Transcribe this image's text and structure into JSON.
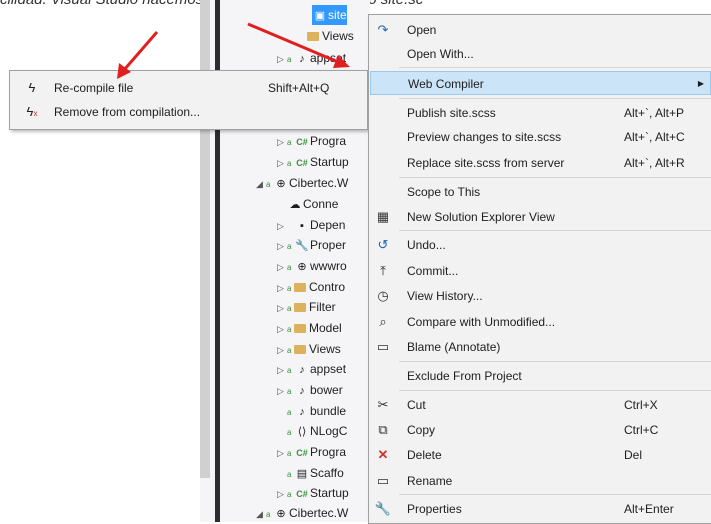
{
  "background_text": "cilidad. Visual Studio nacemos clic derecho en el archivo site.sc",
  "tree": {
    "items": [
      {
        "label": "site",
        "selected": true
      },
      {
        "label": "Views"
      },
      {
        "label": "appset"
      },
      {
        "label": "Progra"
      },
      {
        "label": "Startup"
      },
      {
        "label": "Cibertec.W"
      },
      {
        "label": "Conne"
      },
      {
        "label": "Depen"
      },
      {
        "label": "Proper"
      },
      {
        "label": "wwwro"
      },
      {
        "label": "Contro"
      },
      {
        "label": "Filter"
      },
      {
        "label": "Model"
      },
      {
        "label": "Views"
      },
      {
        "label": "appset"
      },
      {
        "label": "bower"
      },
      {
        "label": "bundle"
      },
      {
        "label": "NLogC"
      },
      {
        "label": "Progra"
      },
      {
        "label": "Scaffo"
      },
      {
        "label": "Startup"
      },
      {
        "label": "Cibertec.W"
      }
    ]
  },
  "submenu": {
    "items": [
      {
        "label": "Re-compile file",
        "shortcut": "Shift+Alt+Q",
        "icon": "lightning-icon"
      },
      {
        "label": "Remove from compilation...",
        "shortcut": "",
        "icon": "lightning-remove-icon"
      }
    ]
  },
  "menu": {
    "items": [
      {
        "label": "Open",
        "shortcut": "",
        "icon": "open-icon"
      },
      {
        "label": "Open With...",
        "shortcut": ""
      },
      {
        "label": "Web Compiler",
        "shortcut": "",
        "has_submenu": true
      },
      {
        "label": "Publish site.scss",
        "shortcut": "Alt+`, Alt+P"
      },
      {
        "label": "Preview changes to site.scss",
        "shortcut": "Alt+`, Alt+C"
      },
      {
        "label": "Replace site.scss from server",
        "shortcut": "Alt+`, Alt+R"
      },
      {
        "label": "Scope to This",
        "shortcut": ""
      },
      {
        "label": "New Solution Explorer View",
        "shortcut": "",
        "icon": "new-window-icon"
      },
      {
        "label": "Undo...",
        "shortcut": "",
        "icon": "undo-icon"
      },
      {
        "label": "Commit...",
        "shortcut": "",
        "icon": "commit-icon"
      },
      {
        "label": "View History...",
        "shortcut": "",
        "icon": "history-icon"
      },
      {
        "label": "Compare with Unmodified...",
        "shortcut": "",
        "icon": "compare-icon"
      },
      {
        "label": "Blame (Annotate)",
        "shortcut": "",
        "icon": "blame-icon"
      },
      {
        "label": "Exclude From Project",
        "shortcut": ""
      },
      {
        "label": "Cut",
        "shortcut": "Ctrl+X",
        "icon": "cut-icon"
      },
      {
        "label": "Copy",
        "shortcut": "Ctrl+C",
        "icon": "copy-icon"
      },
      {
        "label": "Delete",
        "shortcut": "Del",
        "icon": "delete-icon"
      },
      {
        "label": "Rename",
        "shortcut": "",
        "icon": "rename-icon"
      },
      {
        "label": "Properties",
        "shortcut": "Alt+Enter",
        "icon": "wrench-icon"
      }
    ]
  },
  "colors": {
    "highlight": "#cce4f7",
    "selection": "#3399ff",
    "arrow": "#e02020"
  }
}
